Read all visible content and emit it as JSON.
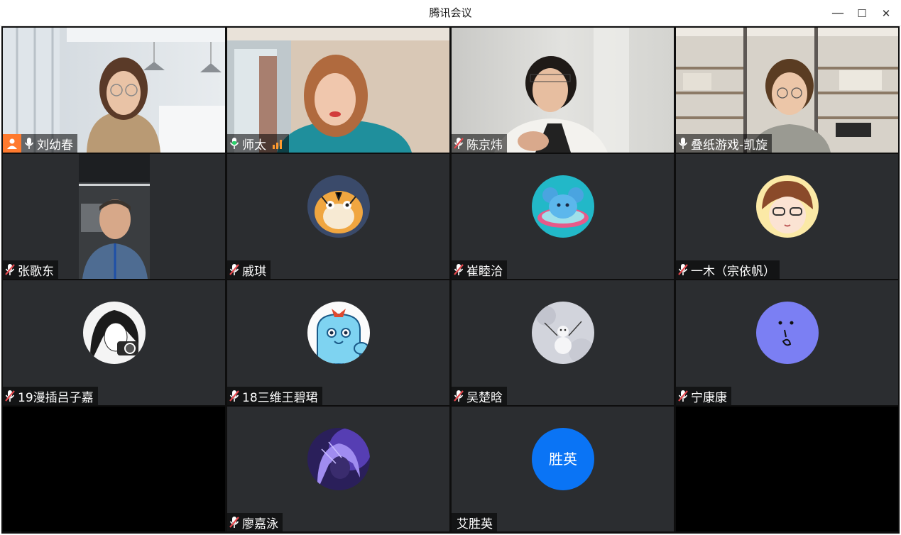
{
  "window": {
    "title": "腾讯会议",
    "controls": {
      "minimize": "—",
      "maximize": "☐",
      "close": "✕"
    }
  },
  "colors": {
    "tile_bg": "#2b2d30",
    "active_border": "#2bb35a",
    "host_badge": "#ff7a2e",
    "muted_mic": "#e5484d",
    "text_avatar": "#0a74f5"
  },
  "participants": [
    {
      "name": "刘幼春",
      "type": "video",
      "mic": "on",
      "host": true
    },
    {
      "name": "师太",
      "type": "video",
      "mic": "on",
      "speaking": true
    },
    {
      "name": "陈京炜",
      "type": "video",
      "mic": "muted"
    },
    {
      "name": "叠纸游戏-凯旋",
      "type": "video",
      "mic": "on"
    },
    {
      "name": "张歌东",
      "type": "video",
      "mic": "muted"
    },
    {
      "name": "戚琪",
      "type": "avatar",
      "mic": "muted",
      "avatar_icon": "tiger-avatar-icon"
    },
    {
      "name": "崔睦洽",
      "type": "avatar",
      "mic": "muted",
      "avatar_icon": "mouse-avatar-icon"
    },
    {
      "name": "一木（宗依帆）",
      "type": "avatar",
      "mic": "muted",
      "avatar_icon": "anime-avatar-icon"
    },
    {
      "name": "19漫插吕子嘉",
      "type": "avatar",
      "mic": "muted",
      "avatar_icon": "manga-camera-avatar-icon"
    },
    {
      "name": "18三维王碧珺",
      "type": "avatar",
      "mic": "muted",
      "avatar_icon": "blue-character-avatar-icon"
    },
    {
      "name": "吴楚晗",
      "type": "avatar",
      "mic": "muted",
      "avatar_icon": "snowman-avatar-icon"
    },
    {
      "name": "宁康康",
      "type": "avatar",
      "mic": "muted",
      "avatar_icon": "purple-face-avatar-icon"
    },
    {
      "name": "廖嘉泳",
      "type": "avatar",
      "mic": "muted",
      "avatar_icon": "purple-girl-avatar-icon"
    },
    {
      "name": "艾胜英",
      "type": "avatar",
      "mic": "none",
      "avatar_text": "胜英"
    }
  ]
}
